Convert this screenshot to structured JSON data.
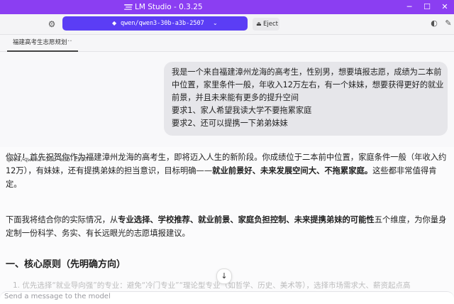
{
  "titlebar": {
    "title": "LM Studio - 0.3.25",
    "minimize": "─",
    "maximize": "☐",
    "close": "✕",
    "logo_icon": "lmstudio-logo"
  },
  "toolbar": {
    "settings_icon": "gear-icon",
    "model_icon": "model-chip-icon",
    "model_name": "qwen/qwen3-30b-a3b-2507",
    "model_chevron": "⌄",
    "eject_icon": "⏏",
    "eject_label": "Eject",
    "right_icons": [
      "palette-icon",
      "wrench-icon"
    ]
  },
  "tabs": [
    {
      "label": "福建高考生志愿规划",
      "more": "···"
    }
  ],
  "chat": {
    "user_message_lines": [
      "我是一个来自福建漳州龙海的高考生，性别男，想要填报志愿，成绩为二本前",
      "中位置，家里条件一般，年收入12万左右，有一个妹妹，想要获得更好的就业",
      "前景，并且未来能有更多的提升空间",
      "要求1、家人希望我读大学不要拖累家庭",
      "要求2、还可以提携一下弟弟妹妹"
    ],
    "assistant_model": "qwen/qwen3-30b-a3b-2507",
    "para1": {
      "l1": "你好！首先祝贺你作为福建漳州龙海的高考生，即将迈入人生的新阶段。你成绩位于二本前中位置，家庭条件一般（年收入约",
      "l2a": "12万），有妹妹，还有提携弟妹的担当意识，目标明确——",
      "l2b": "就业前景好、未来发展空间大、不拖累家庭。",
      "l2c": "这些都非常值得肯",
      "l3": "定。"
    },
    "para2": {
      "a": "下面我将结合你的实际情况，从",
      "b": "专业选择、学校推荐、就业前景、家庭负担控制、未来提携弟妹的可能性",
      "c": "五个维度，为你量身",
      "l2": "定制一份科学、务实、有长远眼光的志愿填报建议。"
    },
    "heading": "一、核心原则（先明确方向）",
    "faded_line": "1. 优先选择“就业导向强”的专业：避免“冷门专业”“理论型专业”（如哲学、历史、美术等），选择市场需求大、薪资起点高",
    "scroll_down": "↓"
  },
  "composer": {
    "placeholder": "Send a message to the model"
  }
}
